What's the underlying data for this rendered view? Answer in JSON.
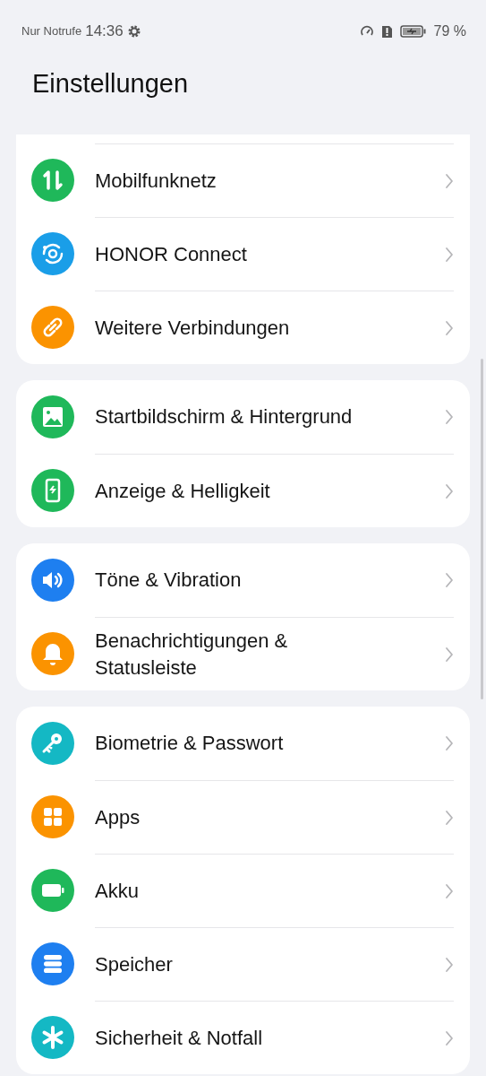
{
  "status_bar": {
    "carrier": "Nur Notrufe",
    "time": "14:36",
    "battery": "79 %"
  },
  "title": "Einstellungen",
  "groups": [
    {
      "items": [
        {
          "label": "Mobilfunknetz",
          "kind": "data",
          "color": "#1fb85a"
        },
        {
          "label": "HONOR Connect",
          "kind": "connect",
          "color": "#1a9ee8"
        },
        {
          "label": "Weitere Verbindungen",
          "kind": "link",
          "color": "#fb9300"
        }
      ]
    },
    {
      "items": [
        {
          "label": "Startbildschirm & Hintergrund",
          "kind": "image",
          "color": "#1fb85a"
        },
        {
          "label": "Anzeige & Helligkeit",
          "kind": "phone",
          "color": "#1fb85a"
        }
      ]
    },
    {
      "items": [
        {
          "label": "Töne & Vibration",
          "kind": "sound",
          "color": "#1e7ff0"
        },
        {
          "label": "Benachrichtigungen & Statusleiste",
          "kind": "bell",
          "color": "#fb9300"
        }
      ]
    },
    {
      "items": [
        {
          "label": "Biometrie & Passwort",
          "kind": "key",
          "color": "#14b8c4"
        },
        {
          "label": "Apps",
          "kind": "apps",
          "color": "#fb9300"
        },
        {
          "label": "Akku",
          "kind": "battery",
          "color": "#1fb85a"
        },
        {
          "label": "Speicher",
          "kind": "storage",
          "color": "#1e7ff0"
        },
        {
          "label": "Sicherheit & Notfall",
          "kind": "asterisk",
          "color": "#14b8c4"
        }
      ]
    }
  ]
}
